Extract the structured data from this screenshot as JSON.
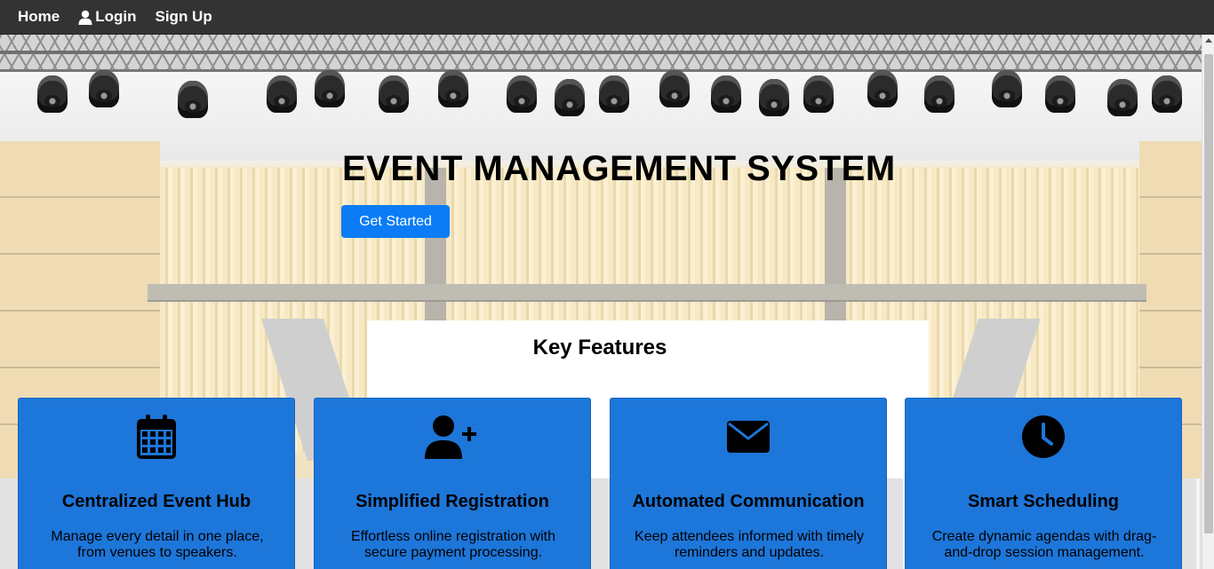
{
  "navbar": {
    "home": "Home",
    "login": "Login",
    "signup": "Sign Up"
  },
  "hero": {
    "title": "EVENT MANAGEMENT SYSTEM",
    "cta": "Get Started"
  },
  "features": {
    "heading": "Key Features",
    "cards": [
      {
        "icon": "calendar-icon",
        "title": "Centralized Event Hub",
        "desc": "Manage every detail in one place, from venues to speakers."
      },
      {
        "icon": "add-user-icon",
        "title": "Simplified Registration",
        "desc": "Effortless online registration with secure payment processing."
      },
      {
        "icon": "envelope-icon",
        "title": "Automated Communication",
        "desc": "Keep attendees informed with timely reminders and updates."
      },
      {
        "icon": "clock-icon",
        "title": "Smart Scheduling",
        "desc": "Create dynamic agendas with drag-and-drop session management."
      }
    ]
  },
  "colors": {
    "navbar": "#333333",
    "accent": "#0b7cf5",
    "card": "#1d76d9"
  }
}
